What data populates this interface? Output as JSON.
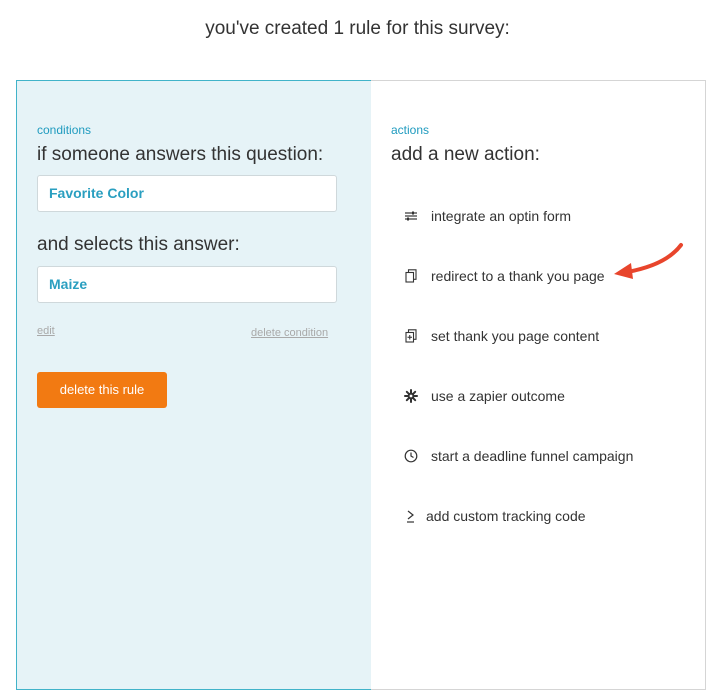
{
  "heading": "you've created 1 rule for this survey:",
  "conditions": {
    "label": "conditions",
    "question_prompt": "if someone answers this question:",
    "question_value": "Favorite Color",
    "answer_prompt": "and selects this answer:",
    "answer_value": "Maize",
    "edit_link": "edit",
    "delete_condition_link": "delete condition",
    "delete_rule_button": "delete this rule"
  },
  "actions": {
    "label": "actions",
    "title": "add a new action:",
    "items": [
      {
        "label": "integrate an optin form",
        "icon": "sliders-icon"
      },
      {
        "label": "redirect to a thank you page",
        "icon": "pages-icon"
      },
      {
        "label": "set thank you page content",
        "icon": "add-page-icon"
      },
      {
        "label": "use a zapier outcome",
        "icon": "gear-icon"
      },
      {
        "label": "start a deadline funnel campaign",
        "icon": "clock-icon"
      },
      {
        "label": "add custom tracking code",
        "icon": "terminal-icon"
      }
    ]
  },
  "colors": {
    "accent": "#1f9bbf",
    "panel_bg": "#e6f3f7",
    "button": "#f27a12",
    "arrow": "#e8452c"
  }
}
